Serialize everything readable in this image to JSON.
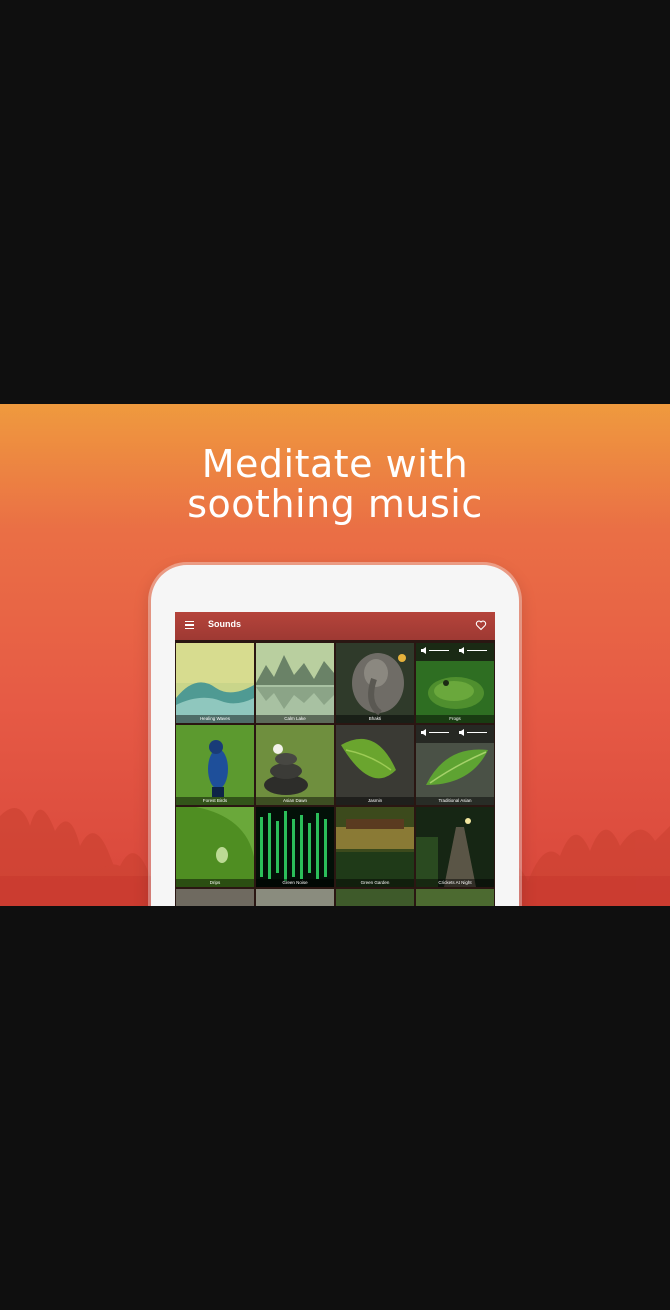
{
  "promo": {
    "headline_line1": "Meditate with",
    "headline_line2": "soothing music"
  },
  "app": {
    "title": "Sounds",
    "colors": {
      "appbar": "#a83d36",
      "banner_top": "#ef9a3e",
      "banner_bottom": "#d8463b"
    }
  },
  "sounds": [
    {
      "label": "Healing Waves",
      "icon": "wave-image"
    },
    {
      "label": "Calm Lake",
      "icon": "lake-image"
    },
    {
      "label": "Bhakti",
      "icon": "ganesha-statue-image"
    },
    {
      "label": "Frogs",
      "icon": "frog-image"
    },
    {
      "label": "Forest Birds",
      "icon": "blue-bird-image"
    },
    {
      "label": "Asian Dawn",
      "icon": "zen-stones-image"
    },
    {
      "label": "Jasmin",
      "icon": "leaf-on-stone-image"
    },
    {
      "label": "Traditional Asian",
      "icon": "leaf-image"
    },
    {
      "label": "Drips",
      "icon": "water-drop-image"
    },
    {
      "label": "Green Noise",
      "icon": "green-bars-image"
    },
    {
      "label": "Green Garden",
      "icon": "garden-image"
    },
    {
      "label": "Crickets At Night",
      "icon": "night-path-image"
    }
  ]
}
